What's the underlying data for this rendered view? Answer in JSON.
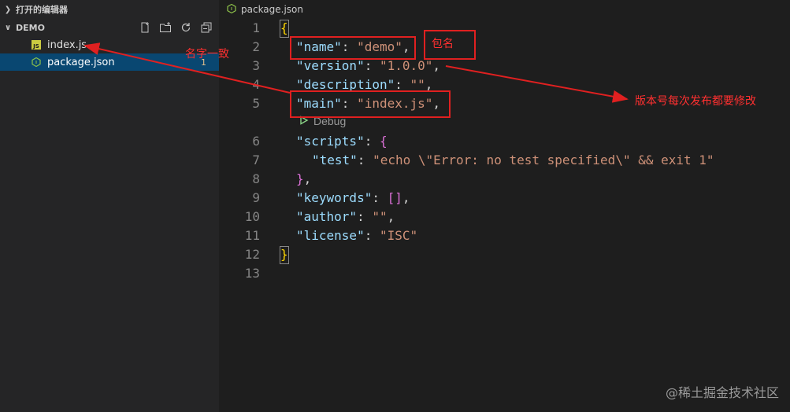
{
  "explorer": {
    "open_editors_label": "打开的编辑器",
    "folder_name": "DEMO",
    "files": [
      {
        "name": "index.js",
        "badge": ""
      },
      {
        "name": "package.json",
        "badge": "1"
      }
    ]
  },
  "editor": {
    "tab_label": "package.json",
    "codelens": "Debug",
    "line_numbers": [
      "1",
      "2",
      "3",
      "4",
      "5",
      "6",
      "7",
      "8",
      "9",
      "10",
      "11",
      "12",
      "13"
    ],
    "code": {
      "l1": "{",
      "name_key": "\"name\"",
      "name_val": "\"demo\"",
      "version_key": "\"version\"",
      "version_val": "\"1.0.0\"",
      "description_key": "\"description\"",
      "description_val": "\"\"",
      "main_key": "\"main\"",
      "main_val": "\"index.js\"",
      "scripts_key": "\"scripts\"",
      "test_key": "\"test\"",
      "test_val": "\"echo \\\"Error: no test specified\\\" && exit 1\"",
      "keywords_key": "\"keywords\"",
      "keywords_val": "[]",
      "author_key": "\"author\"",
      "author_val": "\"\"",
      "license_key": "\"license\"",
      "license_val": "\"ISC\"",
      "l12": "}"
    }
  },
  "annotations": {
    "name_match": "名字一致",
    "package_name": "包名",
    "version_note": "版本号每次发布都要修改",
    "color": "#ff3030"
  },
  "watermark": "@稀土掘金技术社区"
}
